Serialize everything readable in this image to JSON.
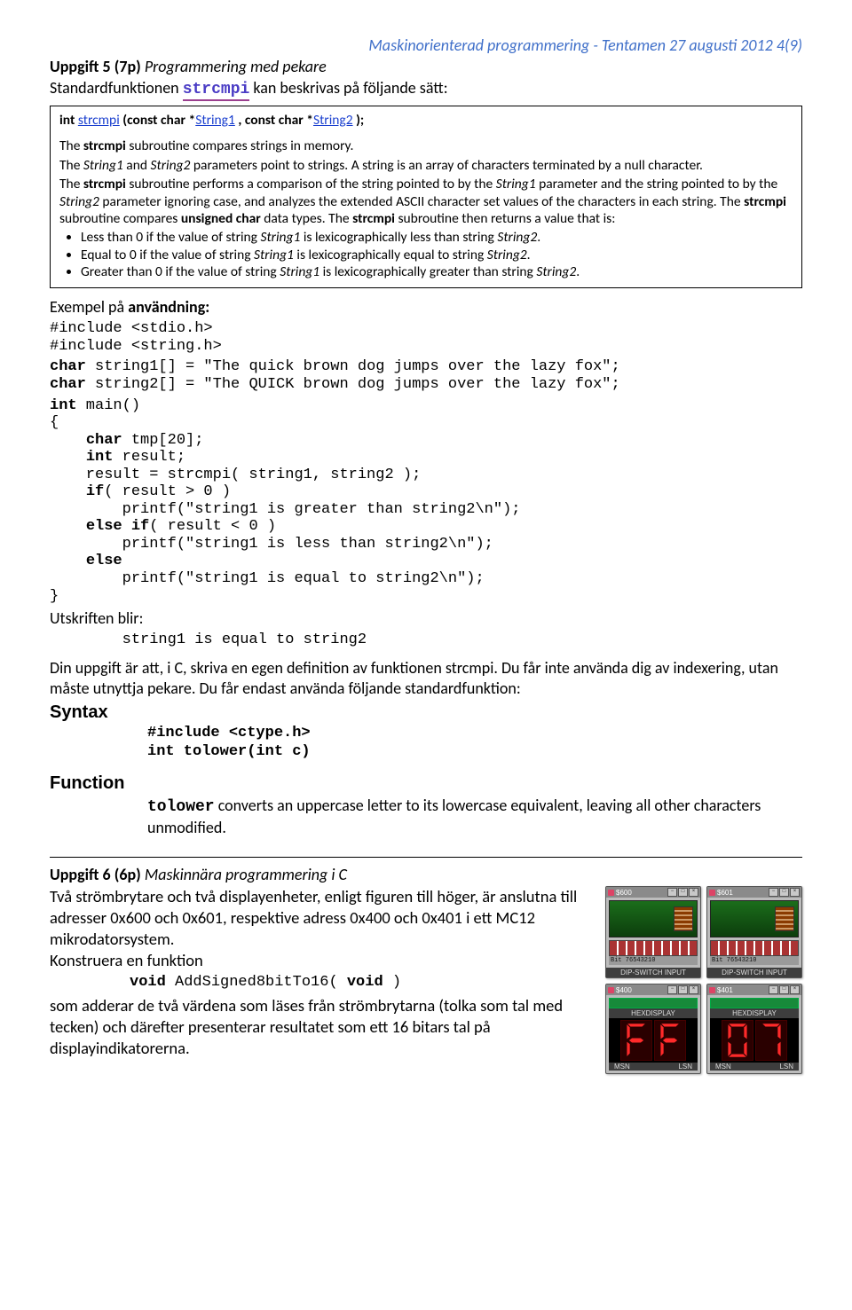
{
  "header": "Maskinorienterad programmering - Tentamen 27 augusti 2012   4(9)",
  "task5": {
    "title_bold": "Uppgift 5 (7p)",
    "title_desc": "Programmering med pekare",
    "intro_prefix": "Standardfunktionen ",
    "intro_func": "strcmpi",
    "intro_suffix": "  kan beskrivas på följande sätt:"
  },
  "sig": {
    "ret": "int ",
    "name": "strcmpi",
    "open": " (const char *",
    "p1": "String1",
    "mid": " , const char *",
    "p2": "String2",
    "end": " );"
  },
  "box": {
    "p1_a": "The ",
    "p1_b": "strcmpi",
    "p1_c": " subroutine compares strings in memory.",
    "p2_a": "The ",
    "p2_s1": "String1",
    "p2_b": " and ",
    "p2_s2": "String2",
    "p2_c": " parameters point to strings. A string is an array of characters terminated by a null character.",
    "p3_a": "The ",
    "p3_b": "strcmpi",
    "p3_c": " subroutine performs a comparison of the string pointed to by the ",
    "p3_s1": "String1",
    "p3_d": " parameter and the string pointed to by the ",
    "p3_s2": "String2",
    "p3_e": " parameter ignoring case, and analyzes the extended ASCII character set values of the characters in each string. The ",
    "p3_f": "strcmpi",
    "p3_g": " subroutine compares ",
    "p3_h": "unsigned char",
    "p3_i": " data types. The ",
    "p3_j": "strcmpi",
    "p3_k": " subroutine then returns a value that is:",
    "li1_a": "Less than 0 if the value of string ",
    "li1_s1": "String1",
    "li1_b": " is lexicographically less than string ",
    "li1_s2": "String2",
    "li1_c": ".",
    "li2_a": "Equal to 0 if the value of string ",
    "li2_s1": "String1",
    "li2_b": " is lexicographically equal to string ",
    "li2_s2": "String2",
    "li2_c": ".",
    "li3_a": "Greater than 0 if the value of string ",
    "li3_s1": "String1",
    "li3_b": " is lexicographically greater than string ",
    "li3_s2": "String2",
    "li3_c": "."
  },
  "example_label": "Exempel på användning:",
  "code_includes": "#include <stdio.h>\n#include <string.h>",
  "code_decl1_kw": "char",
  "code_decl1_rest": " string1[] = \"The quick brown dog jumps over the lazy fox\";",
  "code_decl2_kw": "char",
  "code_decl2_rest": " string2[] = \"The QUICK brown dog jumps over the lazy fox\";",
  "code_main": "int main()\n{\n    char tmp[20];\n    int result;\n    result = strcmpi( string1, string2 );\n    if( result > 0 )\n        printf(\"string1 is greater than string2\\n\");\n    else if( result < 0 )\n        printf(\"string1 is less than string2\\n\");\n    else\n        printf(\"string1 is equal to string2\\n\");\n}",
  "output_label": "Utskriften blir:",
  "output_text": "        string1 is equal to string2",
  "instr_text": "Din uppgift är att, i C, skriva en egen definition av funktionen strcmpi. Du får inte använda dig av indexering, utan måste utnyttja pekare. Du får endast använda följande standardfunktion:",
  "syntax_h": "Syntax",
  "syntax_code": "#include <ctype.h>\nint tolower(int c)",
  "function_h": "Function",
  "function_desc_a": "tolower",
  "function_desc_b": " converts an uppercase letter to its lowercase equivalent, leaving all other characters unmodified.",
  "task6": {
    "title_bold": "Uppgift 6 (6p)",
    "title_desc": "Maskinnära programmering i C",
    "para_a": "Två strömbrytare och två displayenheter, enligt figuren till höger, är anslutna till adresser 0x600 och 0x601, respektive adress 0x400 och 0x401 i ett MC12 mikrodatorsystem.",
    "para_b": "Konstruera en funktion",
    "code_sig_kw1": "void",
    "code_sig_mid": " AddSigned8bitTo16( ",
    "code_sig_kw2": "void",
    "code_sig_end": " )",
    "para_c": "som adderar de två värdena som läses från strömbrytarna (tolka som tal med tecken) och därefter presenterar resultatet som ett 16 bitars tal på displayindikatorerna."
  },
  "sim": {
    "dip": [
      {
        "addr": "$600",
        "bits": "Bit 76543210",
        "label": "DIP-SWITCH INPUT"
      },
      {
        "addr": "$601",
        "bits": "Bit 76543210",
        "label": "DIP-SWITCH INPUT"
      }
    ],
    "hex": [
      {
        "addr": "$400",
        "label": "HEXDISPLAY",
        "digits": "FF",
        "msn": "MSN",
        "lsn": "LSN"
      },
      {
        "addr": "$401",
        "label": "HEXDISPLAY",
        "digits": "07",
        "msn": "MSN",
        "lsn": "LSN"
      }
    ],
    "winbtns": [
      "−",
      "□",
      "×"
    ]
  }
}
